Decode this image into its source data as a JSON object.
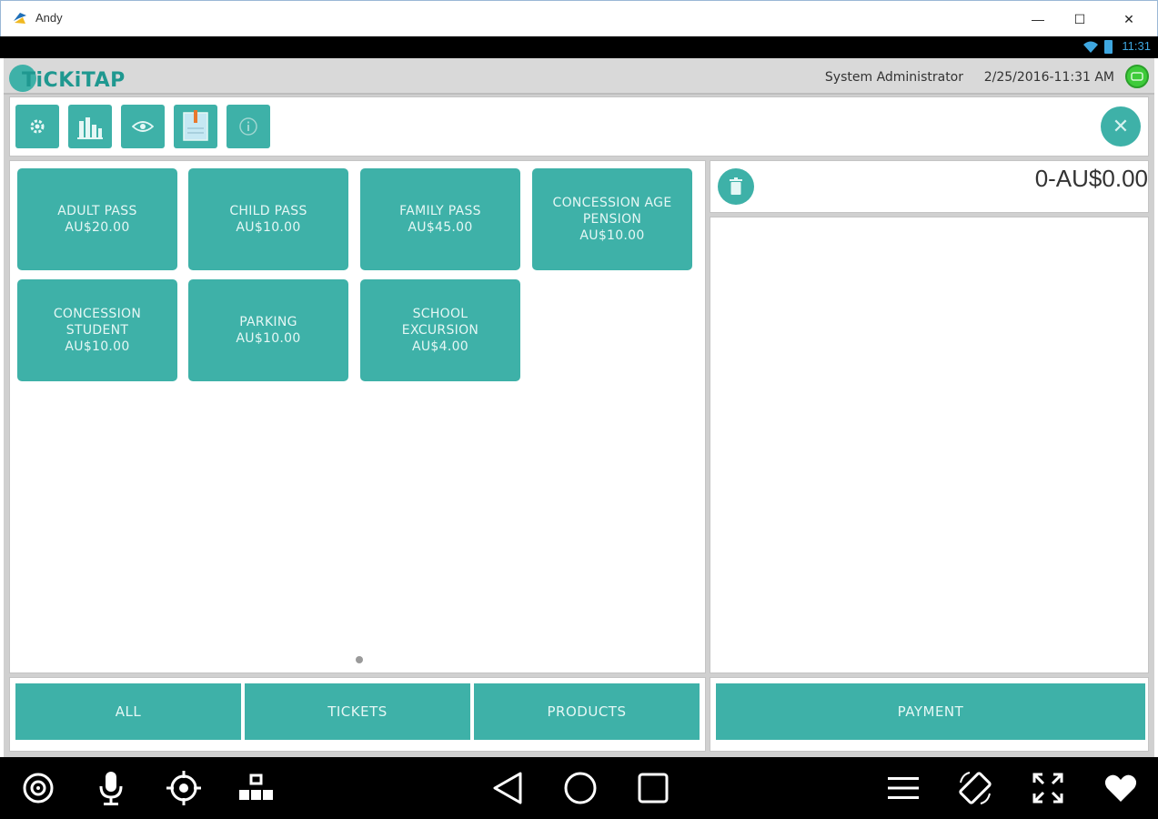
{
  "window": {
    "title": "Andy",
    "minimize_label": "—",
    "maximize_label": "☐",
    "close_label": "✕"
  },
  "status_bar": {
    "time": "11:31"
  },
  "header": {
    "logo_text": "TiCKiTAP",
    "user": "System Administrator",
    "datetime": "2/25/2016-11:31 AM"
  },
  "toolbar": {
    "icons": [
      "gear-icon",
      "report-chart-icon",
      "eye-icon",
      "ledger-book-icon",
      "info-icon"
    ],
    "close_label": "✕"
  },
  "products": [
    {
      "name": "ADULT PASS",
      "price": "AU$20.00"
    },
    {
      "name": "CHILD PASS",
      "price": "AU$10.00"
    },
    {
      "name": "FAMILY PASS",
      "price": "AU$45.00"
    },
    {
      "name": "CONCESSION AGE PENSION",
      "price": "AU$10.00"
    },
    {
      "name": "CONCESSION STUDENT",
      "price": "AU$10.00"
    },
    {
      "name": "PARKING",
      "price": "AU$10.00"
    },
    {
      "name": "SCHOOL EXCURSION",
      "price": "AU$4.00"
    }
  ],
  "cart": {
    "total": "0-AU$0.00"
  },
  "filters": [
    "ALL",
    "TICKETS",
    "PRODUCTS"
  ],
  "payment_label": "PAYMENT",
  "nav_icons": [
    "camera-icon",
    "microphone-icon",
    "location-target-icon",
    "blocks-icon",
    "back-icon",
    "home-icon",
    "recents-icon",
    "menu-icon",
    "rotate-icon",
    "fullscreen-icon",
    "heart-icon"
  ],
  "colors": {
    "accent": "#3eb1a8",
    "status_blue": "#3fa7e0",
    "online_green": "#3ecb3a"
  }
}
